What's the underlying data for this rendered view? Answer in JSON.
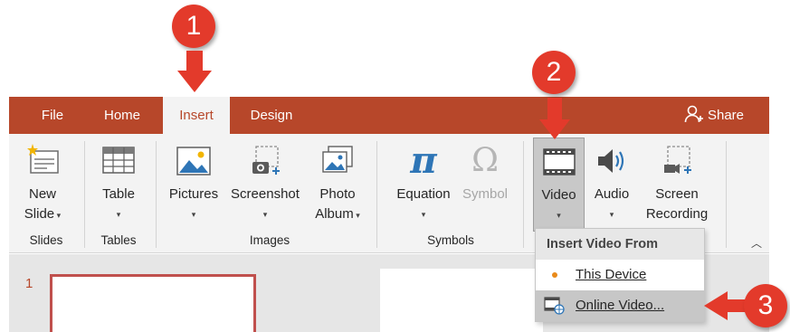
{
  "tabs": [
    {
      "label": "File"
    },
    {
      "label": "Home"
    },
    {
      "label": "Insert"
    },
    {
      "label": "Design"
    }
  ],
  "share_label": "Share",
  "ribbon": {
    "new_slide": {
      "line1": "New",
      "line2": "Slide"
    },
    "table": {
      "label": "Table"
    },
    "pictures": {
      "label": "Pictures"
    },
    "screenshot": {
      "label": "Screenshot"
    },
    "photo_album": {
      "line1": "Photo",
      "line2": "Album"
    },
    "equation": {
      "label": "Equation"
    },
    "symbol": {
      "label": "Symbol"
    },
    "video": {
      "label": "Video"
    },
    "audio": {
      "label": "Audio"
    },
    "screen_recording": {
      "line1": "Screen",
      "line2": "Recording"
    },
    "groups": [
      "Slides",
      "Tables",
      "Images",
      "Symbols"
    ]
  },
  "slide_panel": {
    "slide_number": "1"
  },
  "video_menu": {
    "header": "Insert Video From",
    "items": [
      {
        "label": "This Device",
        "icon": "dot-icon"
      },
      {
        "label": "Online Video...",
        "icon": "online-video-icon"
      }
    ]
  },
  "callouts": [
    "1",
    "2",
    "3"
  ],
  "colors": {
    "accent": "#b7472a",
    "badge": "#e33a2b"
  }
}
